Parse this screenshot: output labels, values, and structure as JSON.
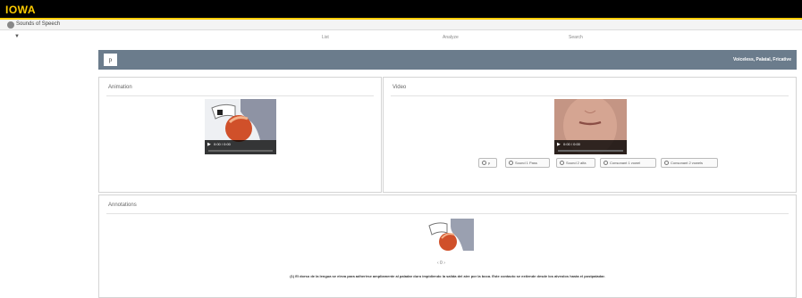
{
  "brand": {
    "logo_text": "IOWA",
    "gold": "#ffcd00",
    "black": "#000000"
  },
  "app": {
    "name": "Sounds of Speech",
    "icon": "app-logo-icon"
  },
  "nav": {
    "caret": "▼",
    "items": [
      "List",
      "Analyze",
      "Search"
    ]
  },
  "header": {
    "symbol": "p",
    "description": "Voiceless, Palatal, Fricative",
    "background": "#6b7c8c"
  },
  "animation_panel": {
    "title": "Animation",
    "player": {
      "time": "0:00 / 0:00",
      "play_icon": "play-icon",
      "progress": 0.0
    }
  },
  "video_panel": {
    "title": "Video",
    "player": {
      "time": "0:00 / 0:00",
      "play_icon": "play-icon",
      "progress": 0.0
    },
    "buttons": [
      "p",
      "Sound 1 Pass",
      "Sound 2 alfa",
      "Consonant 1 vowel",
      "Consonant 2 vowels"
    ]
  },
  "annotations_panel": {
    "title": "Annotations",
    "pager": "‹  0  ›",
    "caption": "(1) El dorso de la lengua se eleva para adherirse ampliamente al paladar duro impidiendo la salida del aire por la boca. Este contacto se extiende desde los alveolos hasta el postpaladar."
  }
}
